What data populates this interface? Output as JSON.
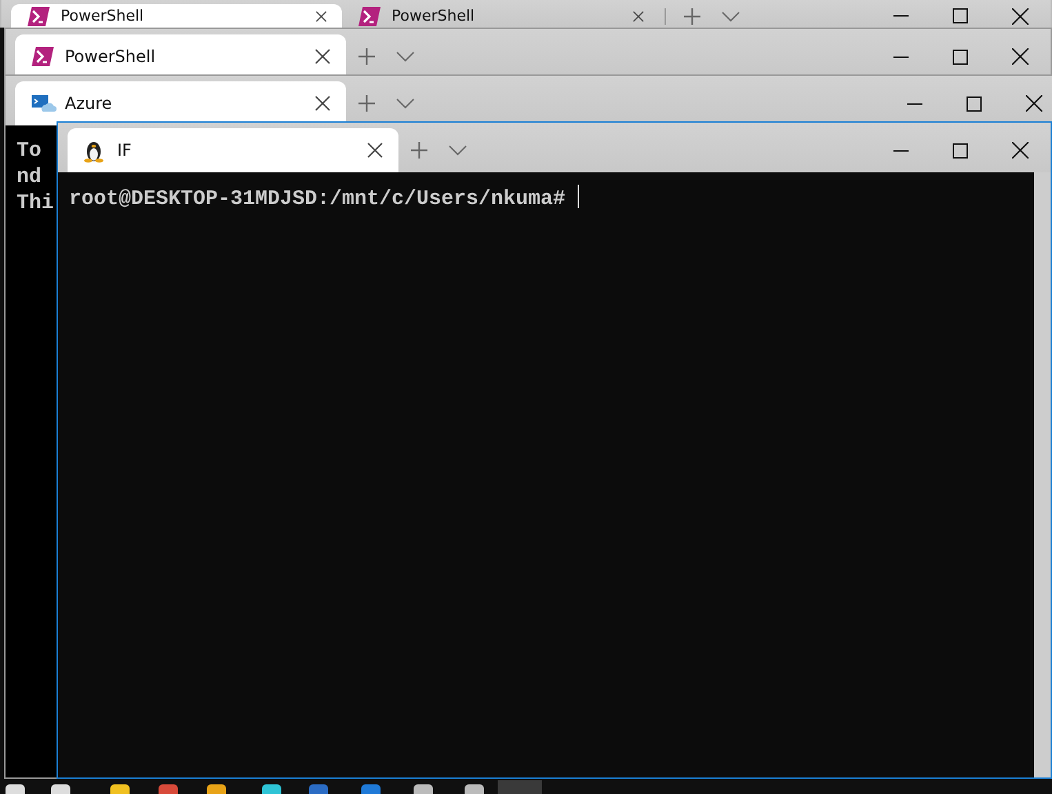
{
  "windows": [
    {
      "tabs": [
        {
          "title": "PowerShell",
          "kind": "powershell",
          "selected": true
        },
        {
          "title": "PowerShell",
          "kind": "powershell",
          "selected": false
        }
      ]
    },
    {
      "tabs": [
        {
          "title": "PowerShell",
          "kind": "powershell",
          "selected": true
        }
      ]
    },
    {
      "tabs": [
        {
          "title": "Azure",
          "kind": "azure",
          "selected": true
        }
      ],
      "terminal": {
        "lines": [
          "To",
          "nd",
          "Thi"
        ]
      }
    },
    {
      "tabs": [
        {
          "title": "IF",
          "kind": "linux",
          "selected": true
        }
      ],
      "terminal": {
        "lines": [
          "root@DESKTOP-31MDJSD:/mnt/c/Users/nkuma#"
        ],
        "cursor_visible": true
      }
    }
  ]
}
